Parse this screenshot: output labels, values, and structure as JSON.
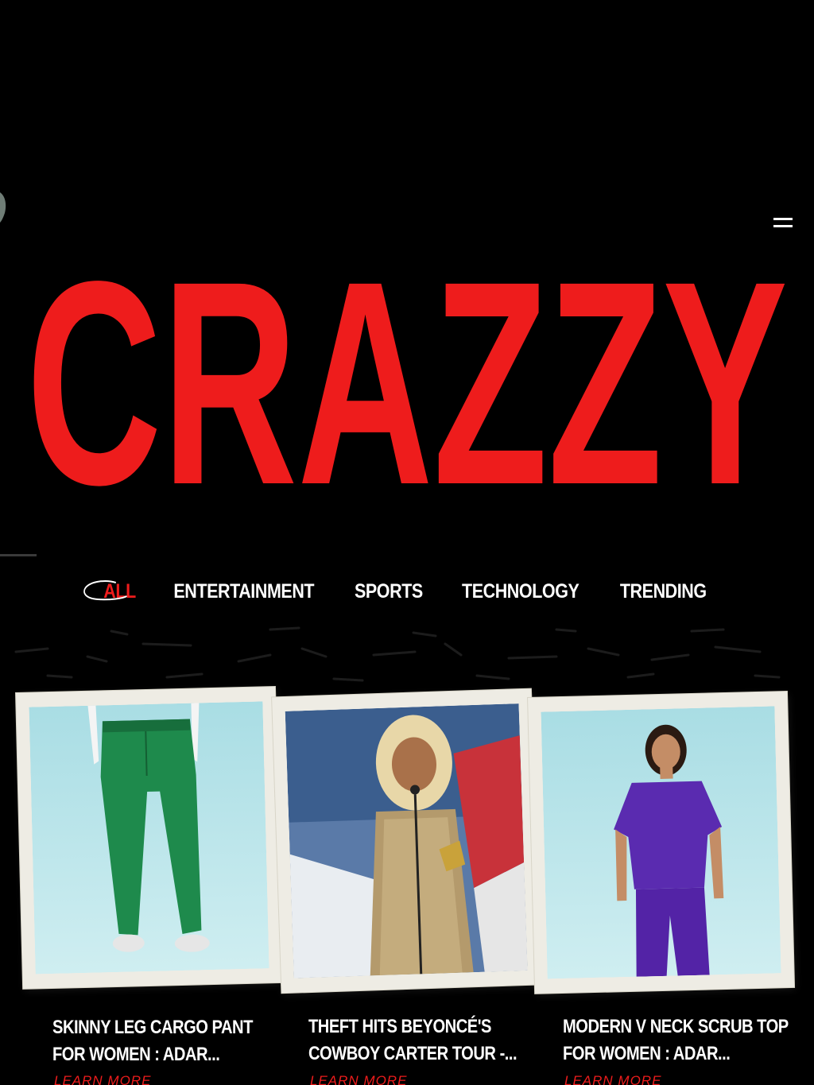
{
  "header": {
    "menu_icon": "hamburger-icon"
  },
  "hero": {
    "title": "CRAZZY",
    "color": "#ee1c1c"
  },
  "nav": {
    "items": [
      {
        "label": "ALL",
        "active": true
      },
      {
        "label": "ENTERTAINMENT",
        "active": false
      },
      {
        "label": "SPORTS",
        "active": false
      },
      {
        "label": "TECHNOLOGY",
        "active": false
      },
      {
        "label": "TRENDING",
        "active": false
      }
    ]
  },
  "cards": [
    {
      "title_line1": "SKINNY LEG CARGO PANT",
      "title_line2": "FOR WOMEN : ADAR...",
      "link": "LEARN MORE",
      "image": "green-scrub-pants-photo"
    },
    {
      "title_line1": "THEFT HITS BEYONCÉ'S",
      "title_line2": "COWBOY CARTER TOUR -...",
      "link": "LEARN MORE",
      "image": "singer-award-photo"
    },
    {
      "title_line1": "MODERN V NECK SCRUB TOP",
      "title_line2": "FOR WOMEN : ADAR...",
      "link": "LEARN MORE",
      "image": "purple-scrubs-photo"
    }
  ],
  "colors": {
    "background": "#000000",
    "accent": "#ee1c1c",
    "text": "#ffffff"
  }
}
